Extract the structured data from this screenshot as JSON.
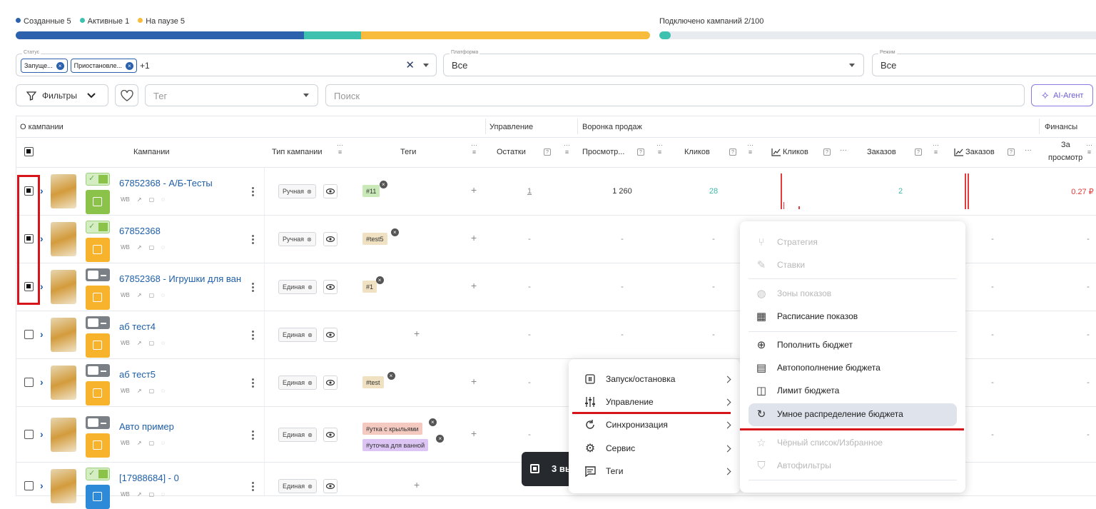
{
  "stats": {
    "legend": [
      {
        "label": "Созданные 5",
        "color": "#2c62ad"
      },
      {
        "label": "Активные 1",
        "color": "#3fc1b0"
      },
      {
        "label": "На паузе 5",
        "color": "#f8bb3c"
      }
    ],
    "bar_segments": [
      {
        "fraction": 0.455,
        "color": "#2c62ad"
      },
      {
        "fraction": 0.09,
        "color": "#3fc1b0"
      },
      {
        "fraction": 0.455,
        "color": "#f8bb3c"
      }
    ],
    "connected_label": "Подключено кампаний 2/100",
    "connected_fraction": 0.02
  },
  "filters": {
    "status": {
      "label": "Статус",
      "chips": [
        "Запуще...",
        "Приостановле..."
      ],
      "more": "+1"
    },
    "platform": {
      "label": "Платформа",
      "value": "Все"
    },
    "mode": {
      "label": "Режим",
      "value": "Все"
    },
    "filters_button": "Фильтры",
    "tag_placeholder": "Тег",
    "search_placeholder": "Поиск",
    "ai_agent": "AI-Агент"
  },
  "table": {
    "groups": [
      "О кампании",
      "Управление",
      "Воронка продаж",
      "Финансы"
    ],
    "columns": [
      "Кампании",
      "Тип кампании",
      "Теги",
      "Остатки",
      "Просмотр...",
      "Кликов",
      "Кликов",
      "Заказов",
      "Заказов",
      "За",
      "просмотр"
    ],
    "rows": [
      {
        "name": "67852368 - А/Б-Тесты",
        "checked": true,
        "active": true,
        "status": "green",
        "type": "Ручная",
        "tags": [
          "#11"
        ],
        "tag_colors": [
          "#c9e9b8"
        ],
        "ostatki": "1",
        "views": "1 260",
        "clicks": "28",
        "orders": "2",
        "price": "0.27 ₽",
        "meta": [
          "WB",
          "↗",
          "▢",
          "◌"
        ]
      },
      {
        "name": "67852368",
        "checked": true,
        "active": true,
        "status": "orange",
        "type": "Ручная",
        "tags": [
          "#test5"
        ],
        "tag_colors": [
          "#f0e1c2"
        ],
        "ostatki": "-",
        "views": "-",
        "clicks": "-",
        "meta": [
          "WB",
          "↗",
          "▢",
          "◌"
        ]
      },
      {
        "name": "67852368 - Игрушки для ван",
        "checked": true,
        "active": false,
        "status": "orange",
        "type": "Единая",
        "tags": [
          "#1"
        ],
        "tag_colors": [
          "#f0e1c2"
        ],
        "ostatki": "-",
        "views": "-",
        "clicks": "-",
        "meta": [
          "WB",
          "↗",
          "▢",
          "◌"
        ]
      },
      {
        "name": "аб тест4",
        "checked": false,
        "active": false,
        "status": "orange",
        "type": "Единая",
        "tags": [],
        "tag_colors": [],
        "ostatki": "-",
        "views": "-",
        "clicks": "-",
        "meta": [
          "WB",
          "↗",
          "▢",
          "◌"
        ]
      },
      {
        "name": "аб тест5",
        "checked": false,
        "active": false,
        "status": "orange",
        "type": "Единая",
        "tags": [
          "#test"
        ],
        "tag_colors": [
          "#f0e1c2"
        ],
        "ostatki": "-",
        "views": "",
        "clicks": "",
        "meta": [
          "WB",
          "↗",
          "▢",
          "◌"
        ]
      },
      {
        "name": "Авто пример",
        "checked": false,
        "active": false,
        "status": "orange",
        "type": "Единая",
        "tags": [
          "#утка с крыльями",
          "#уточка для ванной"
        ],
        "tag_colors": [
          "#f3c9c0",
          "#dcc5f5"
        ],
        "ostatki": "-",
        "views": "",
        "clicks": "",
        "meta": [
          "WB",
          "↗",
          "▢",
          "◌"
        ]
      },
      {
        "name": "[17988684] - 0",
        "checked": false,
        "active": true,
        "status": "blue",
        "type": "Единая",
        "tags": [],
        "tag_colors": [],
        "ostatki": "",
        "views": "",
        "clicks": "",
        "meta": [
          "WB",
          "↗",
          "▢",
          "◌"
        ]
      }
    ]
  },
  "selection_bar": {
    "text": "3 вы"
  },
  "context_menu": [
    {
      "label": "Запуск/остановка",
      "icon": "pause-icon"
    },
    {
      "label": "Управление",
      "icon": "sliders-icon"
    },
    {
      "label": "Синхронизация",
      "icon": "sync-icon"
    },
    {
      "label": "Сервис",
      "icon": "gear-icon"
    },
    {
      "label": "Теги",
      "icon": "tags-icon"
    }
  ],
  "submenu": [
    {
      "label": "Стратегия",
      "disabled": true
    },
    {
      "label": "Ставки",
      "disabled": true
    },
    {
      "label": "Зоны показов",
      "disabled": true
    },
    {
      "label": "Расписание показов",
      "disabled": false
    },
    {
      "label": "Пополнить бюджет",
      "disabled": false
    },
    {
      "label": "Автопополнение бюджета",
      "disabled": false
    },
    {
      "label": "Лимит бюджета",
      "disabled": false
    },
    {
      "label": "Умное распределение бюджета",
      "disabled": false,
      "highlighted": true
    },
    {
      "label": "Чёрный список/Избранное",
      "disabled": true
    },
    {
      "label": "Автофильтры",
      "disabled": true
    }
  ],
  "dash": "-"
}
